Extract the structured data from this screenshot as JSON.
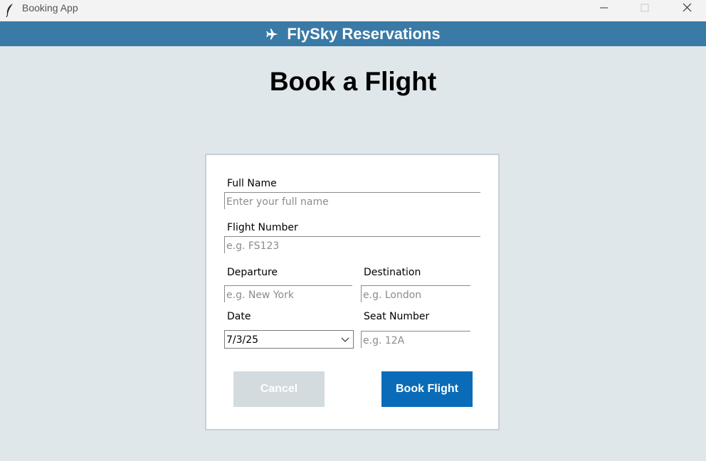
{
  "window": {
    "title": "Booking App"
  },
  "header": {
    "icon": "airplane-icon",
    "title": "FlySky Reservations",
    "color": "#3a7aa6"
  },
  "page": {
    "title": "Book a Flight"
  },
  "form": {
    "full_name": {
      "label": "Full Name",
      "placeholder": "Enter your full name",
      "value": ""
    },
    "flight_number": {
      "label": "Flight Number",
      "placeholder": "e.g. FS123",
      "value": ""
    },
    "departure": {
      "label": "Departure",
      "placeholder": "e.g. New York",
      "value": ""
    },
    "destination": {
      "label": "Destination",
      "placeholder": "e.g. London",
      "value": ""
    },
    "date": {
      "label": "Date",
      "value": "7/3/25"
    },
    "seat_number": {
      "label": "Seat Number",
      "placeholder": "e.g. 12A",
      "value": ""
    }
  },
  "buttons": {
    "cancel": "Cancel",
    "book": "Book Flight"
  },
  "colors": {
    "background": "#e0e7eb",
    "primary_button": "#0a6cb8",
    "cancel_button": "#d3dbdf"
  }
}
